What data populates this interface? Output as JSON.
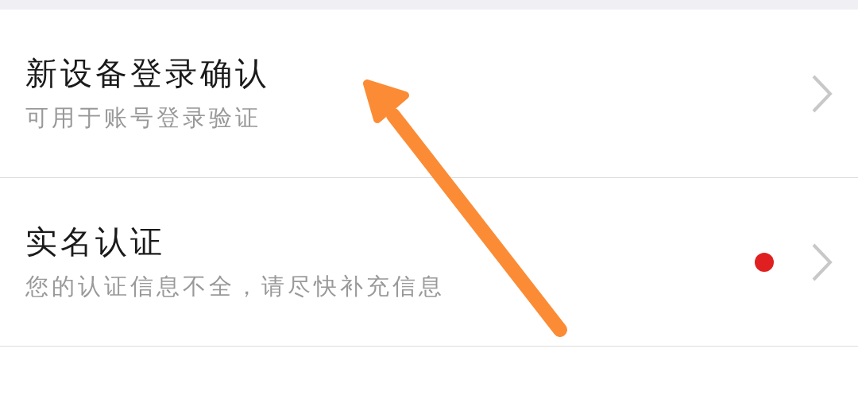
{
  "items": [
    {
      "title": "新设备登录确认",
      "subtitle": "可用于账号登录验证",
      "badge": false
    },
    {
      "title": "实名认证",
      "subtitle": "您的认证信息不全，请尽快补充信息",
      "badge": true
    }
  ],
  "annotation": {
    "kind": "arrow",
    "color": "#fb8c35"
  }
}
